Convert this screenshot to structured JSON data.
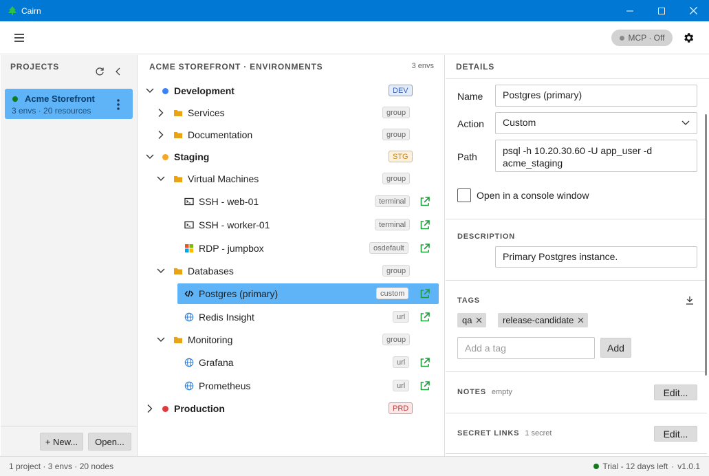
{
  "window": {
    "title": "Cairn"
  },
  "toolbar": {
    "mcp_label": "MCP · Off"
  },
  "projects": {
    "header": "PROJECTS",
    "items": [
      {
        "name": "Acme Storefront",
        "meta": "3 envs · 20 resources"
      }
    ],
    "new_label": "+ New...",
    "open_label": "Open..."
  },
  "environments": {
    "header": "ACME STOREFRONT · ENVIRONMENTS",
    "count": "3 envs",
    "rows": [
      {
        "label": "Development",
        "badge": "DEV"
      },
      {
        "label": "Services",
        "badge": "group"
      },
      {
        "label": "Documentation",
        "badge": "group"
      },
      {
        "label": "Staging",
        "badge": "STG"
      },
      {
        "label": "Virtual Machines",
        "badge": "group"
      },
      {
        "label": "SSH - web-01",
        "badge": "terminal"
      },
      {
        "label": "SSH - worker-01",
        "badge": "terminal"
      },
      {
        "label": "RDP - jumpbox",
        "badge": "osdefault"
      },
      {
        "label": "Databases",
        "badge": "group"
      },
      {
        "label": "Postgres (primary)",
        "badge": "custom"
      },
      {
        "label": "Redis Insight",
        "badge": "url"
      },
      {
        "label": "Monitoring",
        "badge": "group"
      },
      {
        "label": "Grafana",
        "badge": "url"
      },
      {
        "label": "Prometheus",
        "badge": "url"
      },
      {
        "label": "Production",
        "badge": "PRD"
      }
    ]
  },
  "details": {
    "header": "DETAILS",
    "name_label": "Name",
    "name_value": "Postgres (primary)",
    "action_label": "Action",
    "action_value": "Custom",
    "path_label": "Path",
    "path_value": "psql -h 10.20.30.60 -U app_user -d acme_staging",
    "console_label": "Open in a console window",
    "description_label": "DESCRIPTION",
    "description_value": "Primary Postgres instance.",
    "tags_label": "TAGS",
    "tags": [
      "qa",
      "release-candidate"
    ],
    "tag_placeholder": "Add a tag",
    "add_label": "Add",
    "notes_label": "NOTES",
    "notes_hint": "empty",
    "notes_edit": "Edit...",
    "secret_label": "SECRET LINKS",
    "secret_hint": "1 secret",
    "secret_edit": "Edit..."
  },
  "status": {
    "summary": "1 project · 3 envs · 20 nodes",
    "trial": "Trial - 12 days left",
    "version": "v1.0.1"
  },
  "colors": {
    "accent": "#0078d4",
    "selection": "#5fb4f7",
    "env_dev": "#3b82f6",
    "env_stg": "#f5a623",
    "env_prd": "#e03b3b",
    "folder": "#e8a317",
    "external": "#1e9e3a"
  }
}
